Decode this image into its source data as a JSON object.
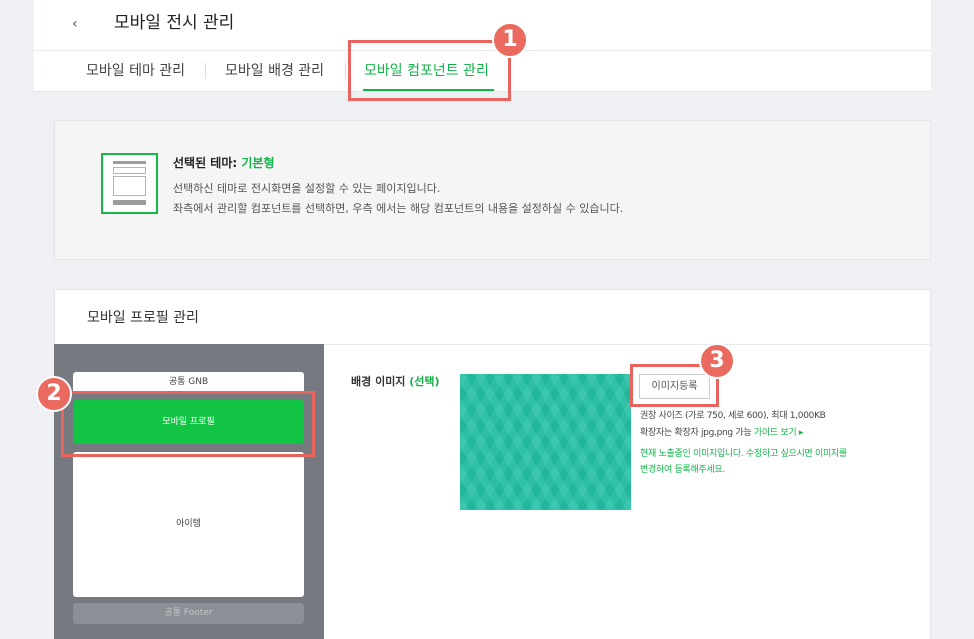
{
  "header": {
    "back_glyph": "‹",
    "title": "모바일 전시 관리",
    "tabs": [
      {
        "label": "모바일 테마 관리"
      },
      {
        "label": "모바일 배경 관리"
      },
      {
        "label": "모바일 컴포넌트 관리"
      }
    ]
  },
  "theme": {
    "label": "선택된 테마:",
    "name": "기본형",
    "desc1": "선택하신 테마로 전시화면을 설정할 수 있는 페이지입니다.",
    "desc2": "좌측에서 관리할 컴포넌트를 선택하면, 우측 에서는 해당 컴포넌트의 내용을 설정하실 수 있습니다."
  },
  "profile": {
    "title": "모바일 프로필 관리",
    "components": {
      "gnb": "공통 GNB",
      "profile": "모바일 프로필",
      "item": "아이템",
      "footer": "공통 Footer"
    },
    "bg_label": "배경 이미지",
    "bg_optional": "(선택)",
    "register_button": "이미지등록",
    "hint1": "권장 사이즈 (가로 750, 세로 600), 최대 1,000KB",
    "hint2": "확장자는 확장자 jpg,png 가능",
    "guide_link": "가이드 보기 ▸",
    "notice1": "현재 노출중인 이미지입니다. 수정하고 싶으시면 이미지를",
    "notice2": "변경하여 등록해주세요."
  },
  "callouts": [
    "1",
    "2",
    "3"
  ],
  "colors": {
    "accent": "#13b34a",
    "callout": "#ea6a60",
    "image_teal": "#24c1a5"
  }
}
